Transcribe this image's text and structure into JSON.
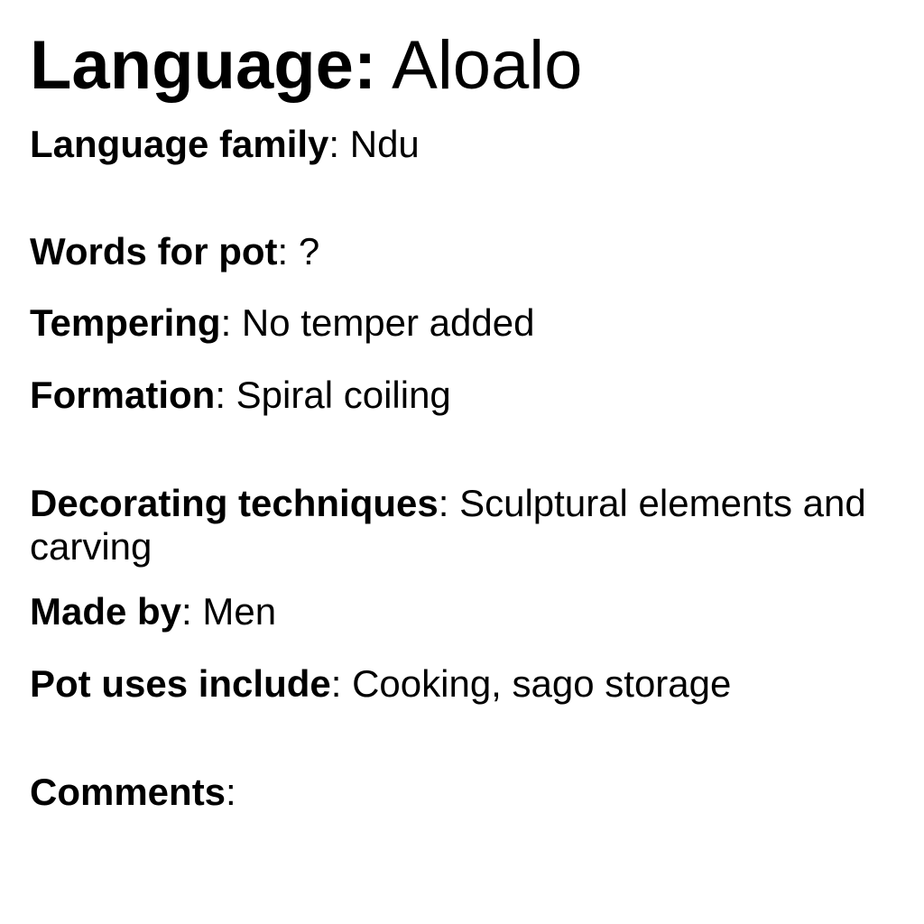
{
  "title": {
    "label": "Language",
    "separator": ":",
    "value": " Aloalo"
  },
  "fields": [
    {
      "label": "Language family",
      "value": " Ndu"
    },
    {
      "label": "Words for pot",
      "value": " ?"
    },
    {
      "label": "Tempering",
      "value": " No temper added"
    },
    {
      "label": "Formation",
      "value": " Spiral coiling"
    },
    {
      "label": "Decorating techniques",
      "value": " Sculptural elements and carving"
    },
    {
      "label": "Made by",
      "value": " Men"
    },
    {
      "label": "Pot uses include",
      "value": " Cooking, sago storage"
    },
    {
      "label": "Comments",
      "value": ""
    }
  ],
  "separator": ":"
}
